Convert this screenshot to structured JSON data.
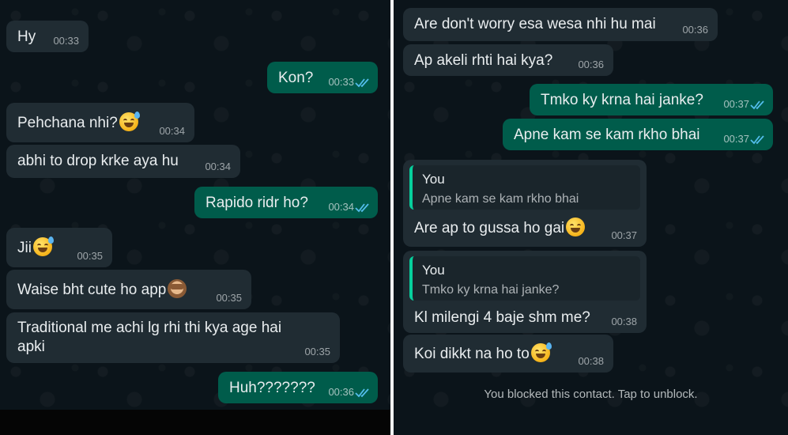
{
  "left_panel": {
    "messages": [
      {
        "text": "Hy",
        "time": "00:33"
      },
      {
        "text": "Kon?",
        "time": "00:33"
      },
      {
        "text": "Pehchana nhi?",
        "time": "00:34"
      },
      {
        "text": "abhi to drop krke aya hu",
        "time": "00:34"
      },
      {
        "text": "Rapido ridr ho?",
        "time": "00:34"
      },
      {
        "text": "Jii",
        "time": "00:35"
      },
      {
        "text": "Waise bht cute ho app",
        "time": "00:35"
      },
      {
        "text": "Traditional me achi lg rhi thi kya age hai apki",
        "time": "00:35"
      },
      {
        "text": "Huh???????",
        "time": "00:36"
      }
    ]
  },
  "right_panel": {
    "messages": [
      {
        "text": "Are don't worry esa wesa nhi hu mai",
        "time": "00:36"
      },
      {
        "text": "Ap akeli rhti hai kya?",
        "time": "00:36"
      },
      {
        "text": "Tmko ky krna hai janke?",
        "time": "00:37"
      },
      {
        "text": "Apne kam se kam rkho bhai",
        "time": "00:37"
      },
      {
        "quote_author": "You",
        "quote_text": "Apne kam se kam rkho bhai",
        "text": "Are ap to gussa ho gai",
        "time": "00:37"
      },
      {
        "quote_author": "You",
        "quote_text": "Tmko ky krna hai janke?",
        "text": "Kl milengi 4 baje shm me?",
        "time": "00:38"
      },
      {
        "text": "Koi dikkt na ho to",
        "time": "00:38"
      }
    ],
    "blocked_notice": "You blocked this contact. Tap to unblock."
  },
  "colors": {
    "background": "#0b141a",
    "incoming_bubble": "#202c33",
    "outgoing_bubble": "#005c4b",
    "read_ticks": "#53bdeb",
    "quote_bar": "#06cf9c"
  },
  "icons": [
    "double-check-icon",
    "grinning-sweat-emoji",
    "see-no-evil-monkey-emoji",
    "tears-of-joy-emoji"
  ]
}
